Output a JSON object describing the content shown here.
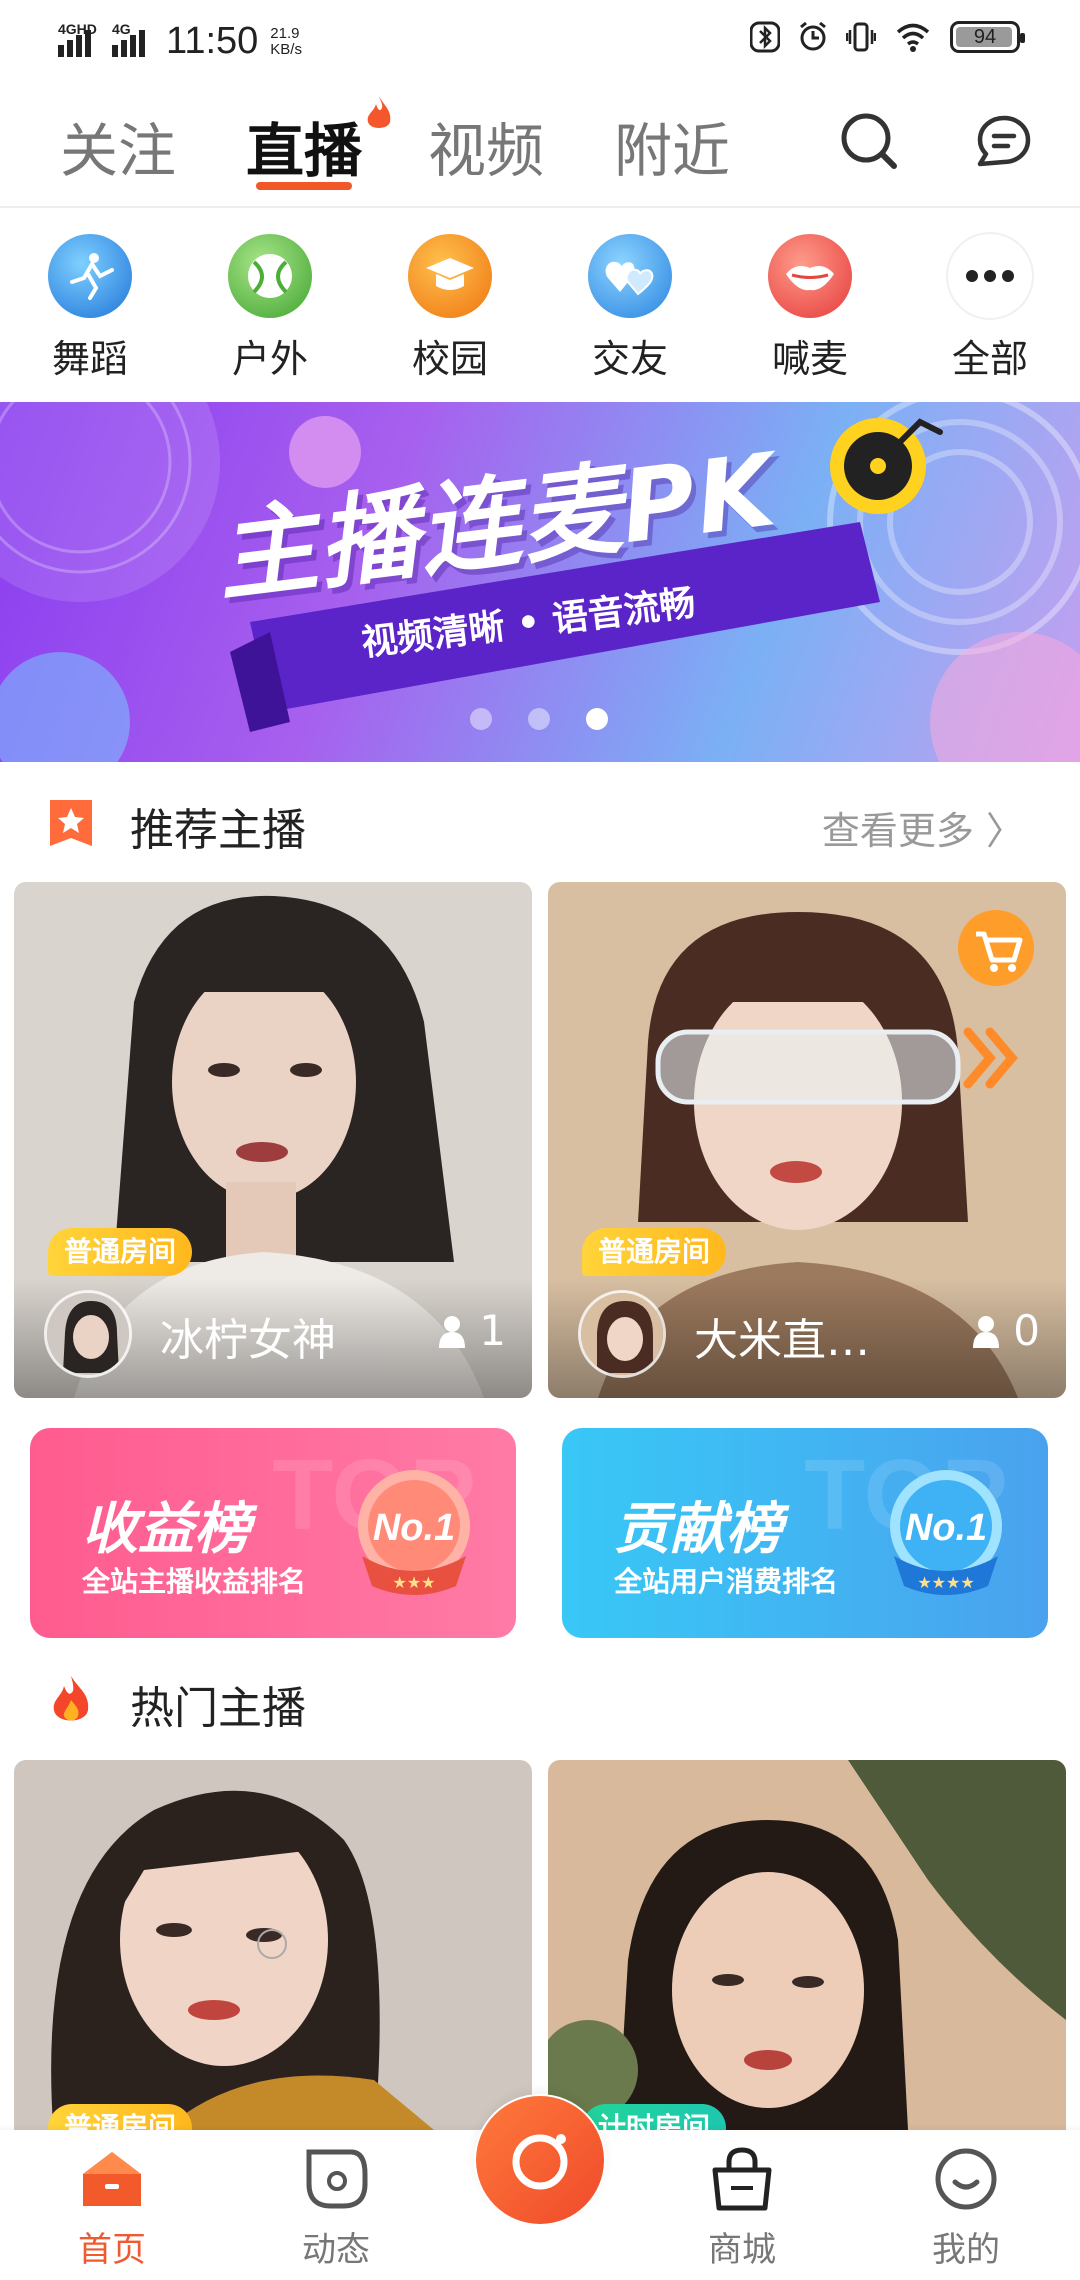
{
  "status_bar": {
    "signal_1_label": "4GHD",
    "signal_2_label": "4G",
    "time": "11:50",
    "speed_value": "21.9",
    "speed_unit": "KB/s",
    "battery": "94"
  },
  "top_nav": {
    "tabs": [
      {
        "label": "关注"
      },
      {
        "label": "直播"
      },
      {
        "label": "视频"
      },
      {
        "label": "附近"
      }
    ],
    "active_tab": "直播"
  },
  "categories": [
    {
      "label": "舞蹈",
      "icon": "dance-icon",
      "color": "#2f8fe8"
    },
    {
      "label": "户外",
      "icon": "outdoor-icon",
      "color": "#62c44a"
    },
    {
      "label": "校园",
      "icon": "campus-icon",
      "color": "#f28a1c"
    },
    {
      "label": "交友",
      "icon": "friends-icon",
      "color": "#3e9ff0"
    },
    {
      "label": "喊麦",
      "icon": "shout-mic-icon",
      "color": "#ef5a52"
    },
    {
      "label": "全部",
      "icon": "more-icon",
      "color": "#ffffff"
    }
  ],
  "banner": {
    "title": "主播连麦PK",
    "subtitle": "视频清晰  •  语音流畅",
    "active_dot": 3,
    "dots": 3
  },
  "recommended": {
    "title": "推荐主播",
    "more_label": "查看更多 〉",
    "cards": [
      {
        "badge": "普通房间",
        "name": "冰柠女神",
        "viewers": "1"
      },
      {
        "badge": "普通房间",
        "name": "大米直…",
        "viewers": "0"
      }
    ]
  },
  "rankings": [
    {
      "title": "收益榜",
      "subtitle": "全站主播收益排名",
      "medal": "No.1",
      "stars": "★★★"
    },
    {
      "title": "贡献榜",
      "subtitle": "全站用户消费排名",
      "medal": "No.1",
      "stars": "★★★★"
    }
  ],
  "hot": {
    "title": "热门主播",
    "cards": [
      {
        "badge": "普通房间"
      },
      {
        "badge": "计时房间"
      }
    ]
  },
  "bottom_nav": {
    "items": [
      {
        "label": "首页"
      },
      {
        "label": "动态"
      },
      {
        "label": "商城"
      },
      {
        "label": "我的"
      }
    ],
    "active": "首页"
  },
  "colors": {
    "accent": "#f2572a",
    "badge_yellow": "#ffc22a",
    "timer_badge": "#28d49a"
  }
}
